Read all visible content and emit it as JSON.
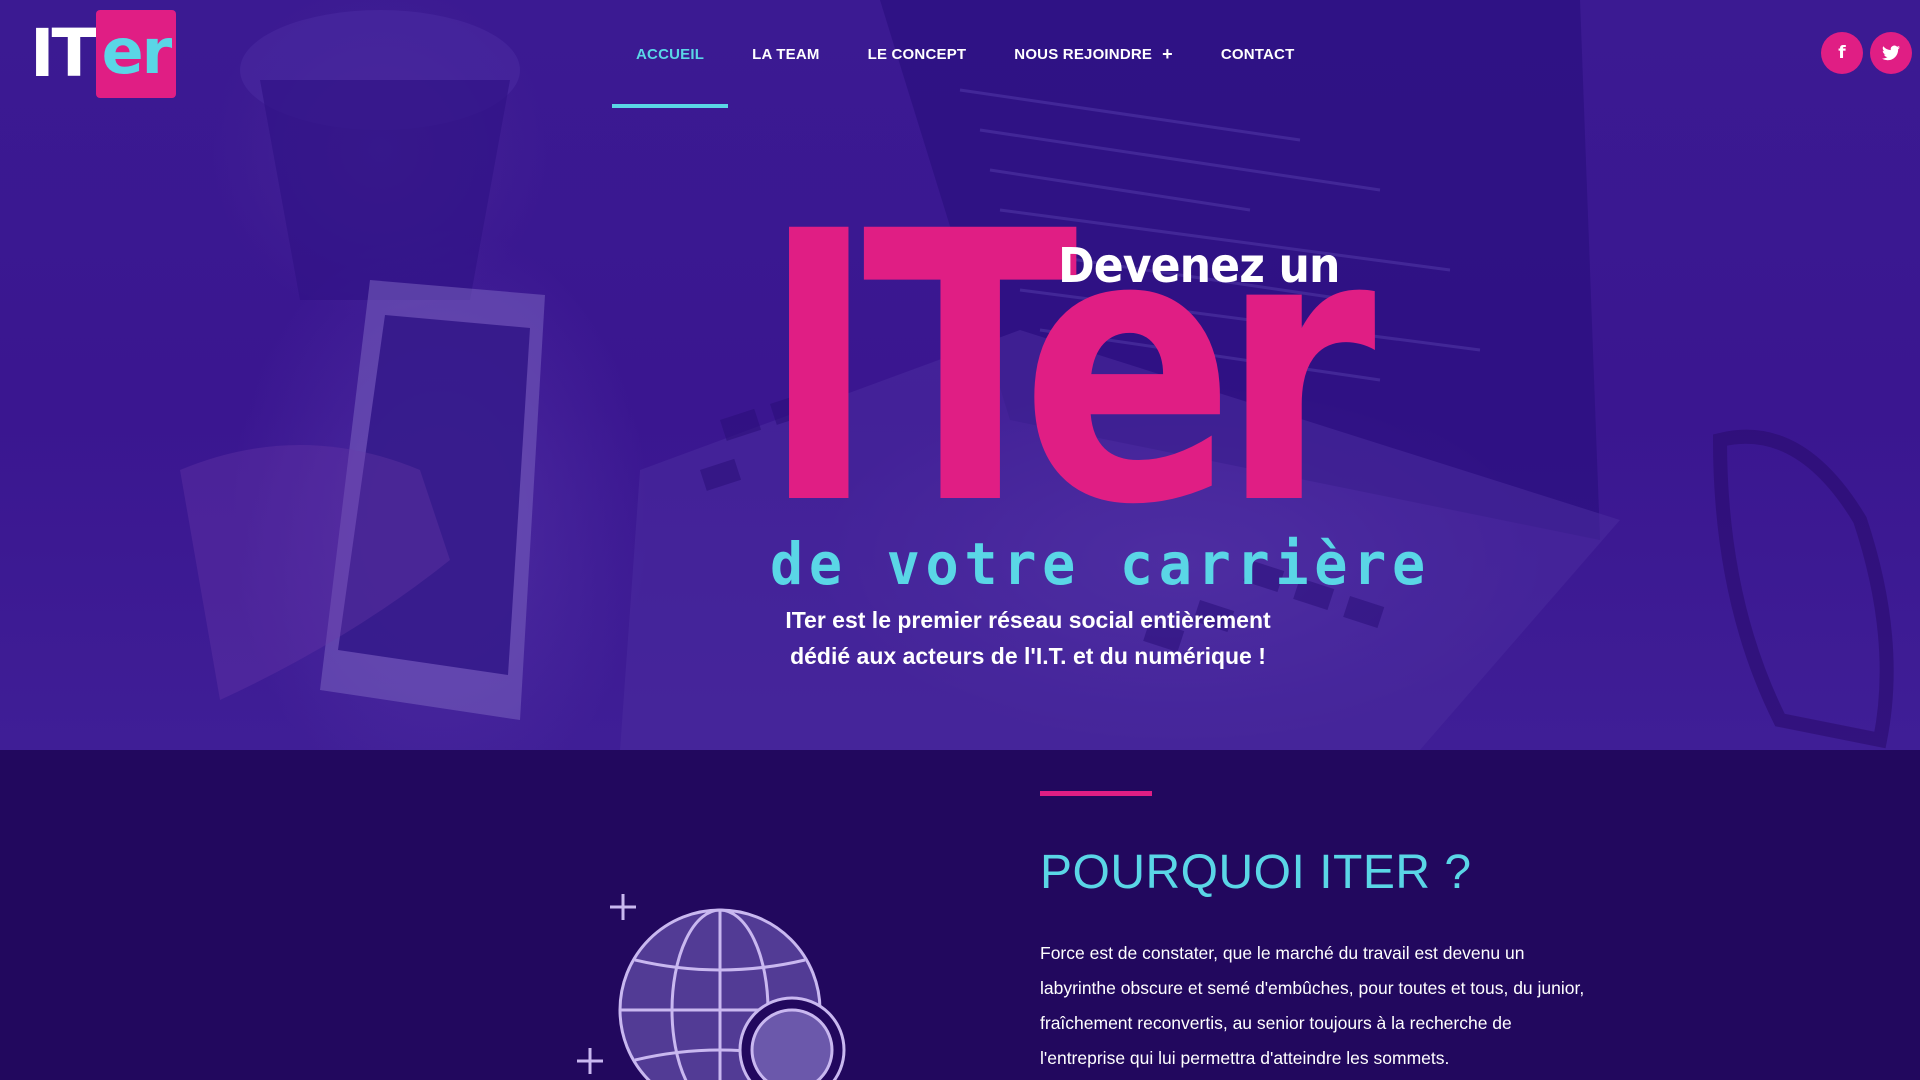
{
  "header": {
    "logo": {
      "part1": "IT",
      "part2": "er"
    },
    "nav": [
      {
        "label": "ACCUEIL",
        "active": true
      },
      {
        "label": "LA TEAM"
      },
      {
        "label": "LE CONCEPT"
      },
      {
        "label": "NOUS REJOINDRE",
        "suffix": "+"
      },
      {
        "label": "CONTACT"
      }
    ],
    "social": [
      {
        "icon": "facebook-icon",
        "glyph": "f"
      },
      {
        "icon": "twitter-icon"
      }
    ]
  },
  "hero": {
    "top_line": "Devenez un",
    "big_word": "ITer",
    "bottom_line": "de votre carrière",
    "subtitle_line1": "ITer est le premier réseau social entièrement",
    "subtitle_line2": "dédié aux acteurs de l'I.T. et du numérique !"
  },
  "section": {
    "title": "POURQUOI ITER ?",
    "text": "Force est de constater, que le marché du travail est devenu un labyrinthe obscure et semé d'embûches, pour toutes et tous, du junior, fraîchement reconvertis, au senior toujours à la recherche de l'entreprise qui lui permettra d'atteindre les sommets."
  },
  "colors": {
    "accent_pink": "#e01e84",
    "accent_cyan": "#5ad6e6",
    "background": "#22085e"
  }
}
